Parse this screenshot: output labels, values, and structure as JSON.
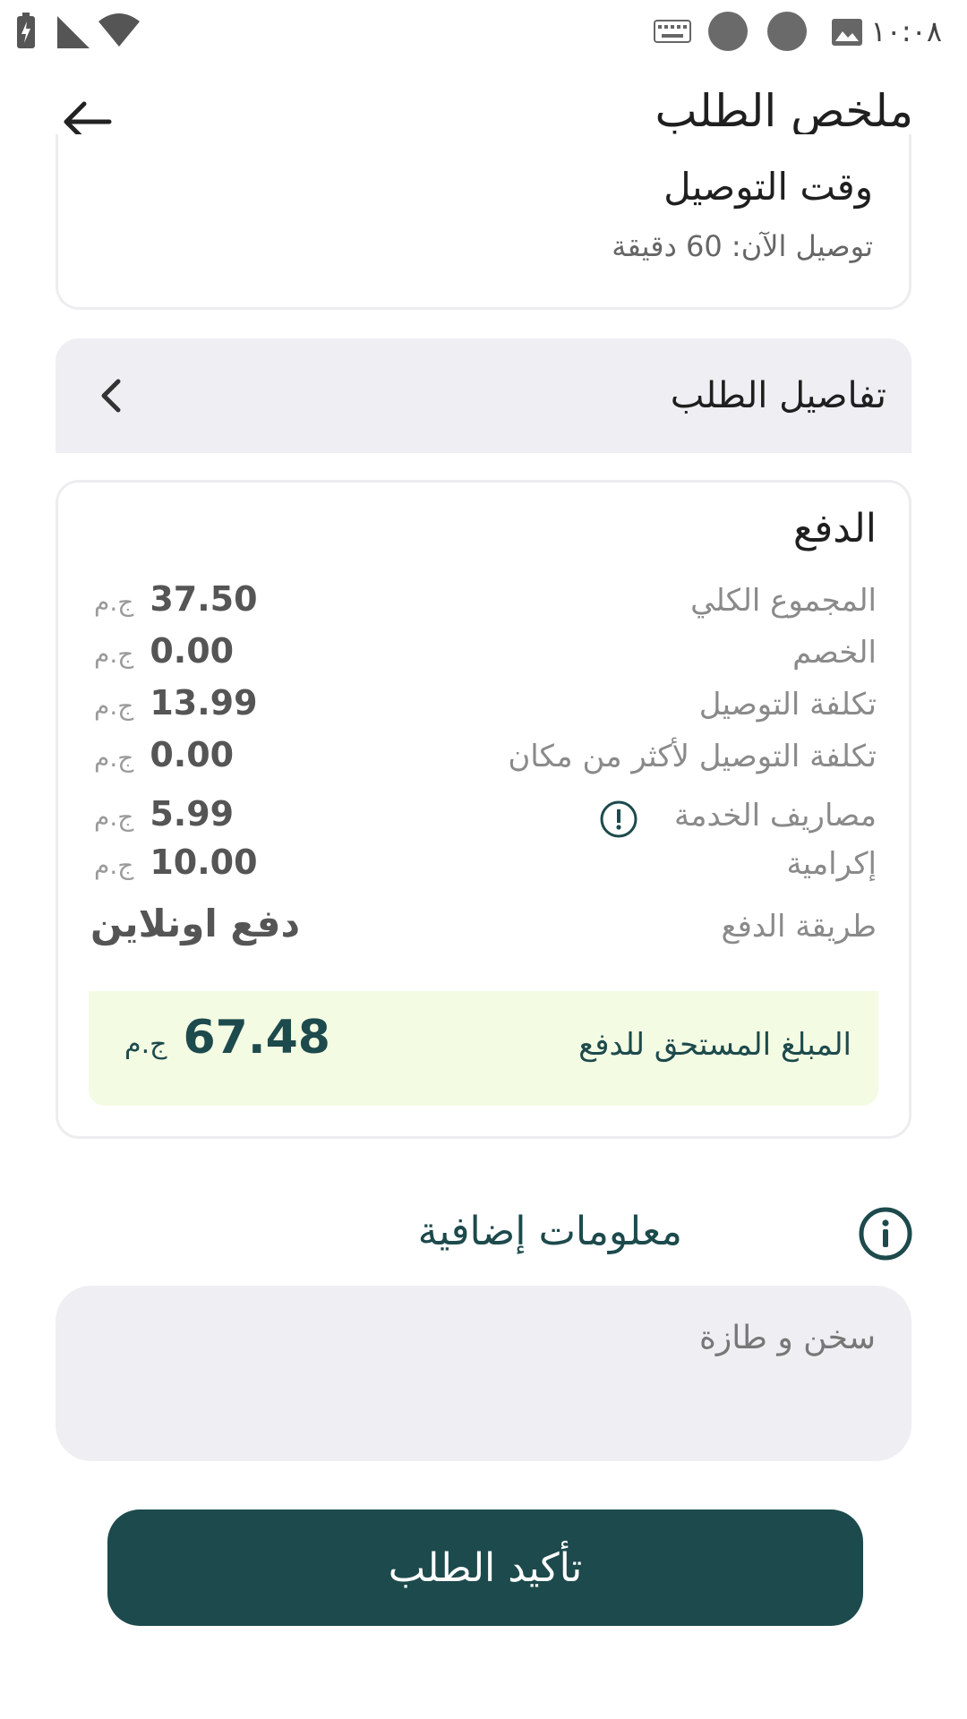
{
  "status_bar": {
    "time": "١٠:٠٨"
  },
  "header": {
    "title": "ملخص الطلب"
  },
  "delivery": {
    "title": "وقت التوصيل",
    "subtitle": "توصيل الآن: 60 دقيقة"
  },
  "order_details": {
    "label": "تفاصيل الطلب"
  },
  "payment": {
    "title": "الدفع",
    "currency": "ج.م",
    "rows": [
      {
        "label": "المجموع الكلي",
        "value": "37.50"
      },
      {
        "label": "الخصم",
        "value": "0.00"
      },
      {
        "label": "تكلفة التوصيل",
        "value": "13.99"
      },
      {
        "label": "تكلفة التوصيل لأكثر من مكان",
        "value": "0.00"
      },
      {
        "label": "مصاريف الخدمة",
        "value": "5.99"
      },
      {
        "label": "إكرامية",
        "value": "10.00"
      }
    ],
    "method_label": "طريقة الدفع",
    "method_value": "دفع اونلاين",
    "due_label": "المبلغ المستحق للدفع",
    "due_value": "67.48"
  },
  "extra_info": {
    "title": "معلومات إضافية",
    "note": "سخن و طازة"
  },
  "confirm_button": {
    "label": "تأكيد الطلب"
  },
  "colors": {
    "primary": "#1d4a4c",
    "due_bg": "#f3fbe3",
    "panel_bg": "#efeff3"
  }
}
